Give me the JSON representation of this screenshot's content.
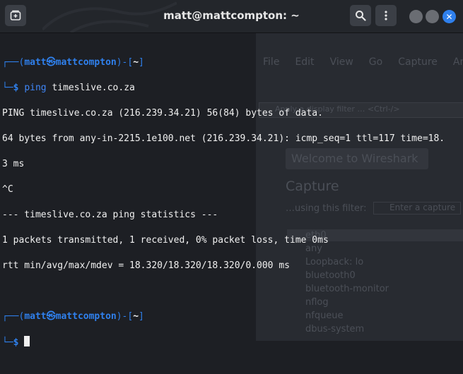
{
  "window": {
    "title": "matt@mattcompton: ~"
  },
  "colors": {
    "accent": "#2f80ed",
    "background": "#1d1f24",
    "titlebar": "#23262b",
    "text": "#f0f0f0"
  },
  "icons": {
    "new_tab": "new-tab-icon",
    "search": "search-icon",
    "menu": "kebab-menu-icon",
    "close": "close-icon"
  },
  "prompt": {
    "open": "┌──(",
    "user": "matt",
    "at": "㉿",
    "host": "mattcompton",
    "mid": ")-[",
    "dir": "~",
    "close": "]",
    "second": "└─",
    "dollar": "$"
  },
  "command": {
    "program": "ping",
    "argument": "timeslive.co.za"
  },
  "output": [
    "PING timeslive.co.za (216.239.34.21) 56(84) bytes of data.",
    "64 bytes from any-in-2215.1e100.net (216.239.34.21): icmp_seq=1 ttl=117 time=18.",
    "3 ms",
    "^C",
    "--- timeslive.co.za ping statistics ---",
    "1 packets transmitted, 1 received, 0% packet loss, time 0ms",
    "rtt min/avg/max/mdev = 18.320/18.320/18.320/0.000 ms"
  ],
  "background_app": {
    "menu": [
      "File",
      "Edit",
      "View",
      "Go",
      "Capture",
      "Analyz"
    ],
    "filter_placeholder": "Apply a display filter … <Ctrl-/>",
    "welcome": "Welcome to Wireshark",
    "capture_heading": "Capture",
    "using_filter": "…using this filter:",
    "capture_filter_placeholder": "Enter a capture",
    "interfaces": [
      "eth0",
      "any",
      "Loopback: lo",
      "bluetooth0",
      "bluetooth-monitor",
      "nflog",
      "nfqueue",
      "dbus-system"
    ]
  }
}
